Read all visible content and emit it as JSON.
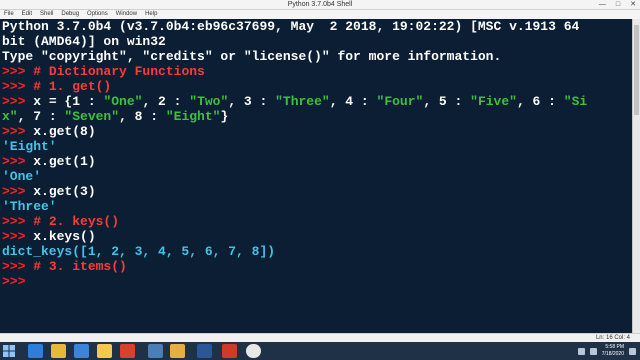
{
  "window": {
    "title": "Python 3.7.0b4 Shell",
    "controls": [
      "—",
      "□",
      "✕"
    ]
  },
  "menu": [
    "File",
    "Edit",
    "Shell",
    "Debug",
    "Options",
    "Window",
    "Help"
  ],
  "shell": {
    "banner": [
      "Python 3.7.0b4 (v3.7.0b4:eb96c37699, May  2 2018, 19:02:22) [MSC v.1913 64",
      "bit (AMD64)] on win32",
      "Type \"copyright\", \"credits\" or \"license()\" for more information."
    ],
    "prompt": ">>> ",
    "comment_dict": "# Dictionary Functions",
    "comment_get": "# 1. get()",
    "assign_line1": {
      "head": "x = {1 : ",
      "s1": "\"One\"",
      "p2": ", 2 : ",
      "s2": "\"Two\"",
      "p3": ", 3 : ",
      "s3": "\"Three\"",
      "p4": ", 4 : ",
      "s4": "\"Four\"",
      "p5": ", 5 : ",
      "s5": "\"Five\"",
      "p6": ", 6 : ",
      "s6a": "\"Si"
    },
    "assign_line2": {
      "s6b": "x\"",
      "p7": ", 7 : ",
      "s7": "\"Seven\"",
      "p8": ", 8 : ",
      "s8": "\"Eight\"",
      "tail": "}"
    },
    "cmd_get8": "x.get(8)",
    "out_get8": "'Eight'",
    "cmd_get1": "x.get(1)",
    "out_get1": "'One'",
    "cmd_get3": "x.get(3)",
    "out_get3": "'Three'",
    "comment_keys": "# 2. keys()",
    "cmd_keys": "x.keys()",
    "out_keys": "dict_keys([1, 2, 3, 4, 5, 6, 7, 8])",
    "comment_items": "# 3. items()"
  },
  "status": {
    "position": "Ln: 16  Col: 4"
  },
  "taskbar": {
    "icons": [
      "start-icon",
      "ie-icon",
      "folder-icon",
      "store-icon",
      "python-icon",
      "media-icon",
      "word-icon",
      "chrome-icon",
      "app-icon"
    ],
    "time": "5:58 PM",
    "date": "7/18/2020"
  },
  "colors": {
    "background": "#0b1e33",
    "prompt": "#ff2020",
    "comment": "#ff3a3a",
    "string": "#3ec13a",
    "output": "#41c4e8",
    "text": "#ffffff"
  }
}
